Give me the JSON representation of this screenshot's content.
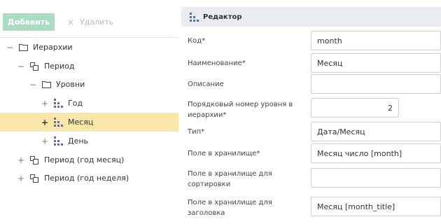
{
  "toolbar": {
    "add_label": "Добавить",
    "delete_label": "Удалить",
    "delete_icon": "×"
  },
  "tree": [
    {
      "label": "Иерархии",
      "toggle": "−",
      "icon": "folder-icon"
    },
    {
      "label": "Период",
      "toggle": "−",
      "icon": "hierarchy-icon"
    },
    {
      "label": "Уровни",
      "toggle": "−",
      "icon": "folder-icon"
    },
    {
      "label": "Год",
      "toggle": "+",
      "icon": "level-icon"
    },
    {
      "label": "Месяц",
      "toggle": "+",
      "icon": "level-icon",
      "selected": true
    },
    {
      "label": "День",
      "toggle": "+",
      "icon": "level-icon"
    },
    {
      "label": "Период (год месяц)",
      "toggle": "+",
      "icon": "hierarchy-icon"
    },
    {
      "label": "Период (год неделя)",
      "toggle": "+",
      "icon": "hierarchy-icon"
    }
  ],
  "editor": {
    "title": "Редактор",
    "fields": [
      {
        "label": "Код*",
        "value": "month"
      },
      {
        "label": "Наименование*",
        "value": "Месяц"
      },
      {
        "label": "Описание",
        "value": ""
      },
      {
        "label": "Порядковый номер уровня в иерархии*",
        "value": "2"
      },
      {
        "label": "Тип*",
        "value": "Дата/Месяц"
      },
      {
        "label": "Поле в хранилище*",
        "value": "Месяц число [month]"
      },
      {
        "label": "Поле в хранилище для сортировки",
        "value": ""
      },
      {
        "label": "Поле в хранилище для заголовка",
        "value": "Месяц [month_title]"
      }
    ]
  },
  "colors": {
    "accent": "#a9dcc2",
    "selected_row": "#fbe7a8",
    "level_icon": "#5b6fa6"
  }
}
